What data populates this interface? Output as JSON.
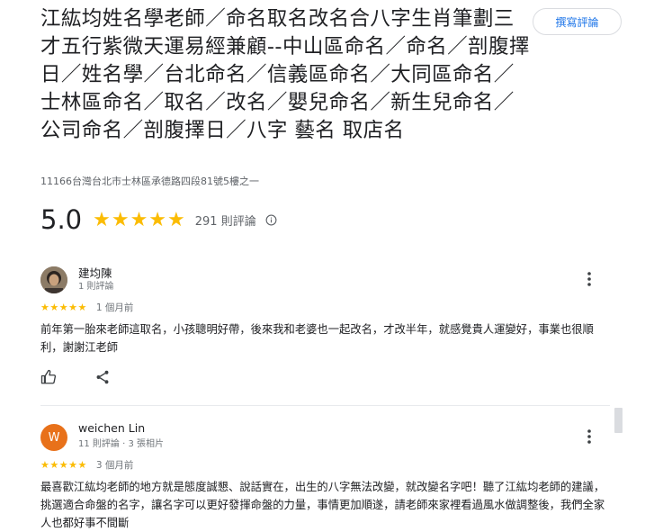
{
  "place": {
    "title": "江紘均姓名學老師／命名取名改名合八字生肖筆劃三才五行紫微天運易經兼顧--中山區命名／命名／剖腹擇日／姓名學／台北命名／信義區命名／大同區命名／士林區命名／取名／改名／嬰兒命名／新生兒命名／公司命名／剖腹擇日／八字 藝名 取店名",
    "address": "11166台灣台北市士林區承德路四段81號5樓之一",
    "write_review_label": "撰寫評論",
    "rating": "5.0",
    "stars": "★★★★★",
    "review_count": "291 則評論"
  },
  "reviews": [
    {
      "name": "建均陳",
      "meta": "1 則評論",
      "stars": "★★★★★",
      "time": "1 個月前",
      "text": "前年第一胎來老師這取名，小孩聰明好帶，後來我和老婆也一起改名，才改半年，就感覺貴人運變好，事業也很順利，謝謝江老師"
    },
    {
      "name": "weichen Lin",
      "meta": "11 則評論 · 3 張相片",
      "avatar_letter": "W",
      "stars": "★★★★★",
      "time": "3 個月前",
      "text": "最喜歡江紘均老師的地方就是態度誠懇、說話實在，出生的八字無法改變，就改變名字吧！聽了江紘均老師的建議，挑選適合命盤的名字，讓名字可以更好發揮命盤的力量，事情更加順遂，請老師來家裡看過風水做調整後，我們全家人也都好事不間斷"
    }
  ],
  "colors": {
    "star": "#fbbc04",
    "link": "#1a73e8",
    "avatar_w": "#e8711a"
  },
  "icons": [
    "info-icon",
    "more-vert-icon",
    "thumb-up-icon",
    "share-icon"
  ]
}
